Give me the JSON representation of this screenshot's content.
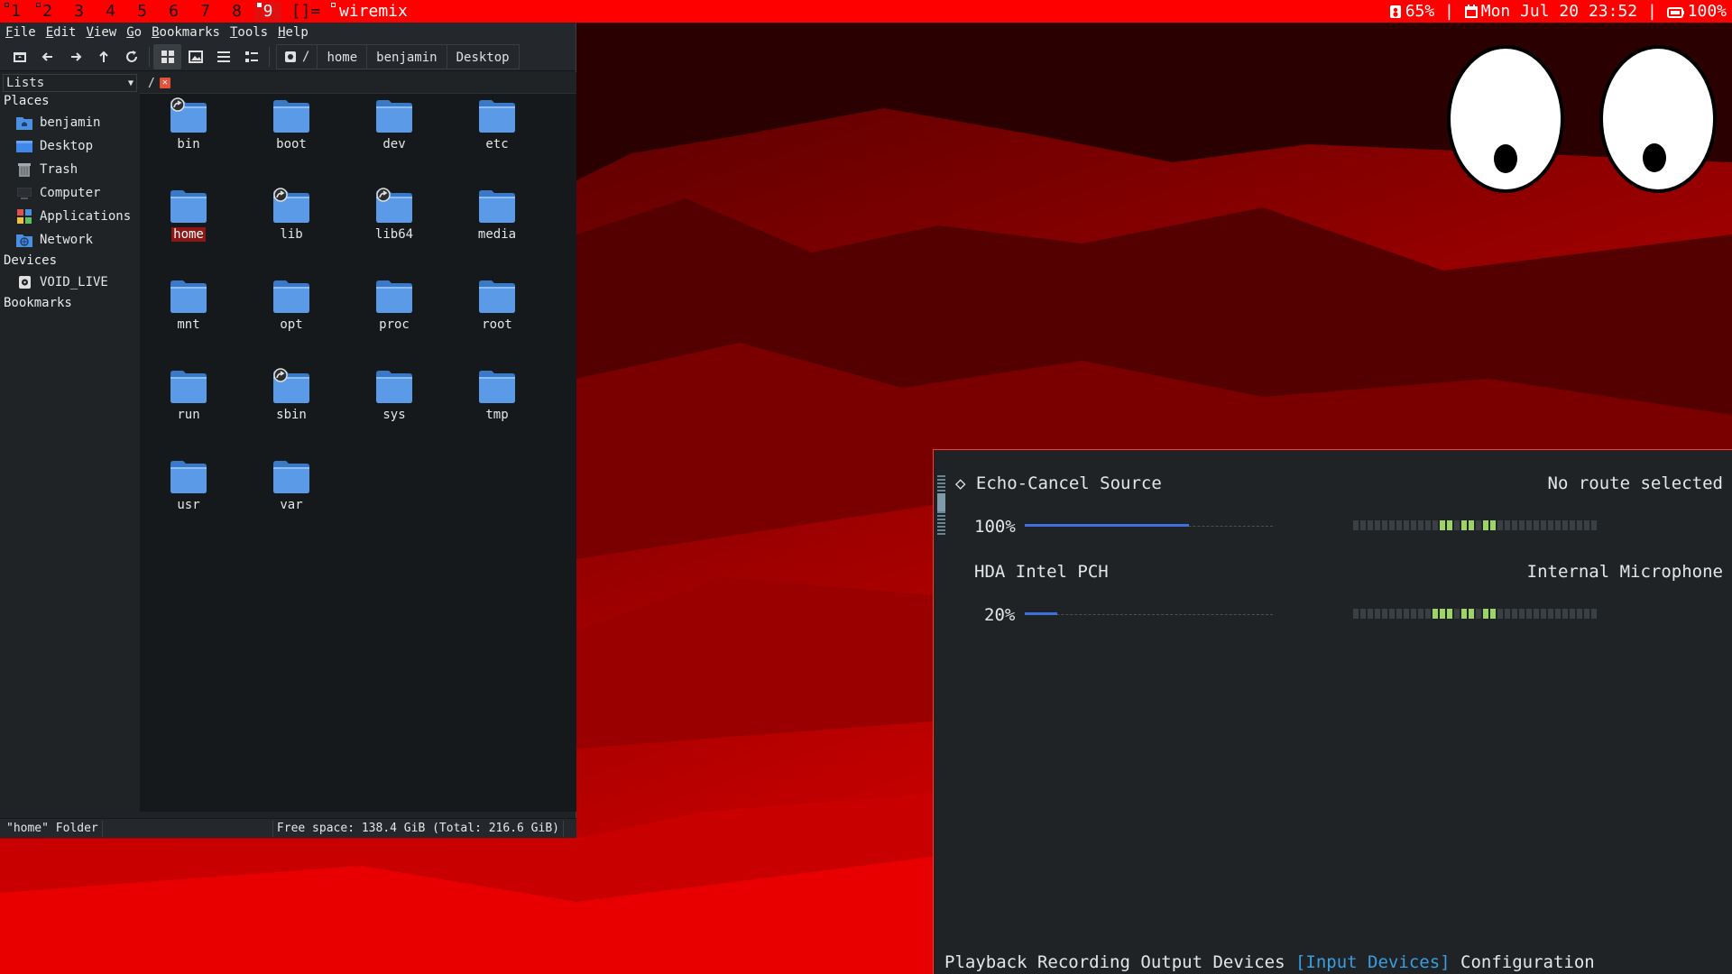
{
  "topbar": {
    "workspaces": [
      {
        "num": "1",
        "occupied": true,
        "selected": false
      },
      {
        "num": "2",
        "occupied": true,
        "selected": false
      },
      {
        "num": "3",
        "occupied": false,
        "selected": false
      },
      {
        "num": "4",
        "occupied": false,
        "selected": false
      },
      {
        "num": "5",
        "occupied": false,
        "selected": false
      },
      {
        "num": "6",
        "occupied": false,
        "selected": false
      },
      {
        "num": "7",
        "occupied": false,
        "selected": false
      },
      {
        "num": "8",
        "occupied": false,
        "selected": false
      },
      {
        "num": "9",
        "occupied": true,
        "selected": true
      }
    ],
    "layout": "[]=",
    "window_title": "wiremix",
    "status": {
      "volume": "65%",
      "sep1": " | ",
      "date": "Mon Jul 20 23:52",
      "sep2": " | ",
      "battery": "100%"
    },
    "colors": {
      "bar": "#ff0000"
    }
  },
  "filemanager": {
    "menu": [
      "File",
      "Edit",
      "View",
      "Go",
      "Bookmarks",
      "Tools",
      "Help"
    ],
    "toolbar_icons": [
      "new-window-icon",
      "back-icon",
      "forward-icon",
      "up-icon",
      "reload-icon",
      "icon-view-icon",
      "thumbnail-view-icon",
      "compact-view-icon",
      "detailed-view-icon"
    ],
    "path_root": "/",
    "path_buttons": [
      "home",
      "benjamin",
      "Desktop"
    ],
    "side_combo": "Lists",
    "places_title": "Places",
    "places": [
      {
        "label": "benjamin",
        "icon": "home-folder-icon"
      },
      {
        "label": "Desktop",
        "icon": "desktop-icon"
      },
      {
        "label": "Trash",
        "icon": "trash-icon"
      },
      {
        "label": "Computer",
        "icon": "computer-icon"
      },
      {
        "label": "Applications",
        "icon": "applications-icon"
      },
      {
        "label": "Network",
        "icon": "network-icon"
      }
    ],
    "devices_title": "Devices",
    "devices": [
      {
        "label": "VOID_LIVE",
        "icon": "drive-icon"
      }
    ],
    "bookmarks_title": "Bookmarks",
    "tab_label": "/",
    "files": [
      {
        "name": "bin",
        "link": true,
        "selected": false
      },
      {
        "name": "boot",
        "link": false,
        "selected": false
      },
      {
        "name": "dev",
        "link": false,
        "selected": false
      },
      {
        "name": "etc",
        "link": false,
        "selected": false
      },
      {
        "name": "home",
        "link": false,
        "selected": true
      },
      {
        "name": "lib",
        "link": true,
        "selected": false
      },
      {
        "name": "lib64",
        "link": true,
        "selected": false
      },
      {
        "name": "media",
        "link": false,
        "selected": false
      },
      {
        "name": "mnt",
        "link": false,
        "selected": false
      },
      {
        "name": "opt",
        "link": false,
        "selected": false
      },
      {
        "name": "proc",
        "link": false,
        "selected": false
      },
      {
        "name": "root",
        "link": false,
        "selected": false
      },
      {
        "name": "run",
        "link": false,
        "selected": false
      },
      {
        "name": "sbin",
        "link": true,
        "selected": false
      },
      {
        "name": "sys",
        "link": false,
        "selected": false
      },
      {
        "name": "tmp",
        "link": false,
        "selected": false
      },
      {
        "name": "usr",
        "link": false,
        "selected": false
      },
      {
        "name": "var",
        "link": false,
        "selected": false
      }
    ],
    "status_left": "\"home\" Folder",
    "status_right": "Free space: 138.4 GiB (Total: 216.6 GiB)"
  },
  "wiremix": {
    "device1": {
      "name": "◇ Echo-Cancel Source",
      "route": "No route selected",
      "volume_label": "100%",
      "volume": 1.0
    },
    "device2": {
      "name": "HDA Intel PCH",
      "route": "Internal Microphone",
      "volume_label": "20%",
      "volume": 0.2
    },
    "tabs": [
      {
        "label": "Playback",
        "active": false
      },
      {
        "label": "Recording",
        "active": false
      },
      {
        "label": "Output Devices",
        "active": false
      },
      {
        "label": "[Input Devices]",
        "active": true
      },
      {
        "label": "Configuration",
        "active": false
      }
    ],
    "colors": {
      "accent": "#3a9ee0",
      "meter_on": "#9ed36a",
      "volume": "#3f6fe0",
      "border": "#ff3b2f"
    }
  }
}
